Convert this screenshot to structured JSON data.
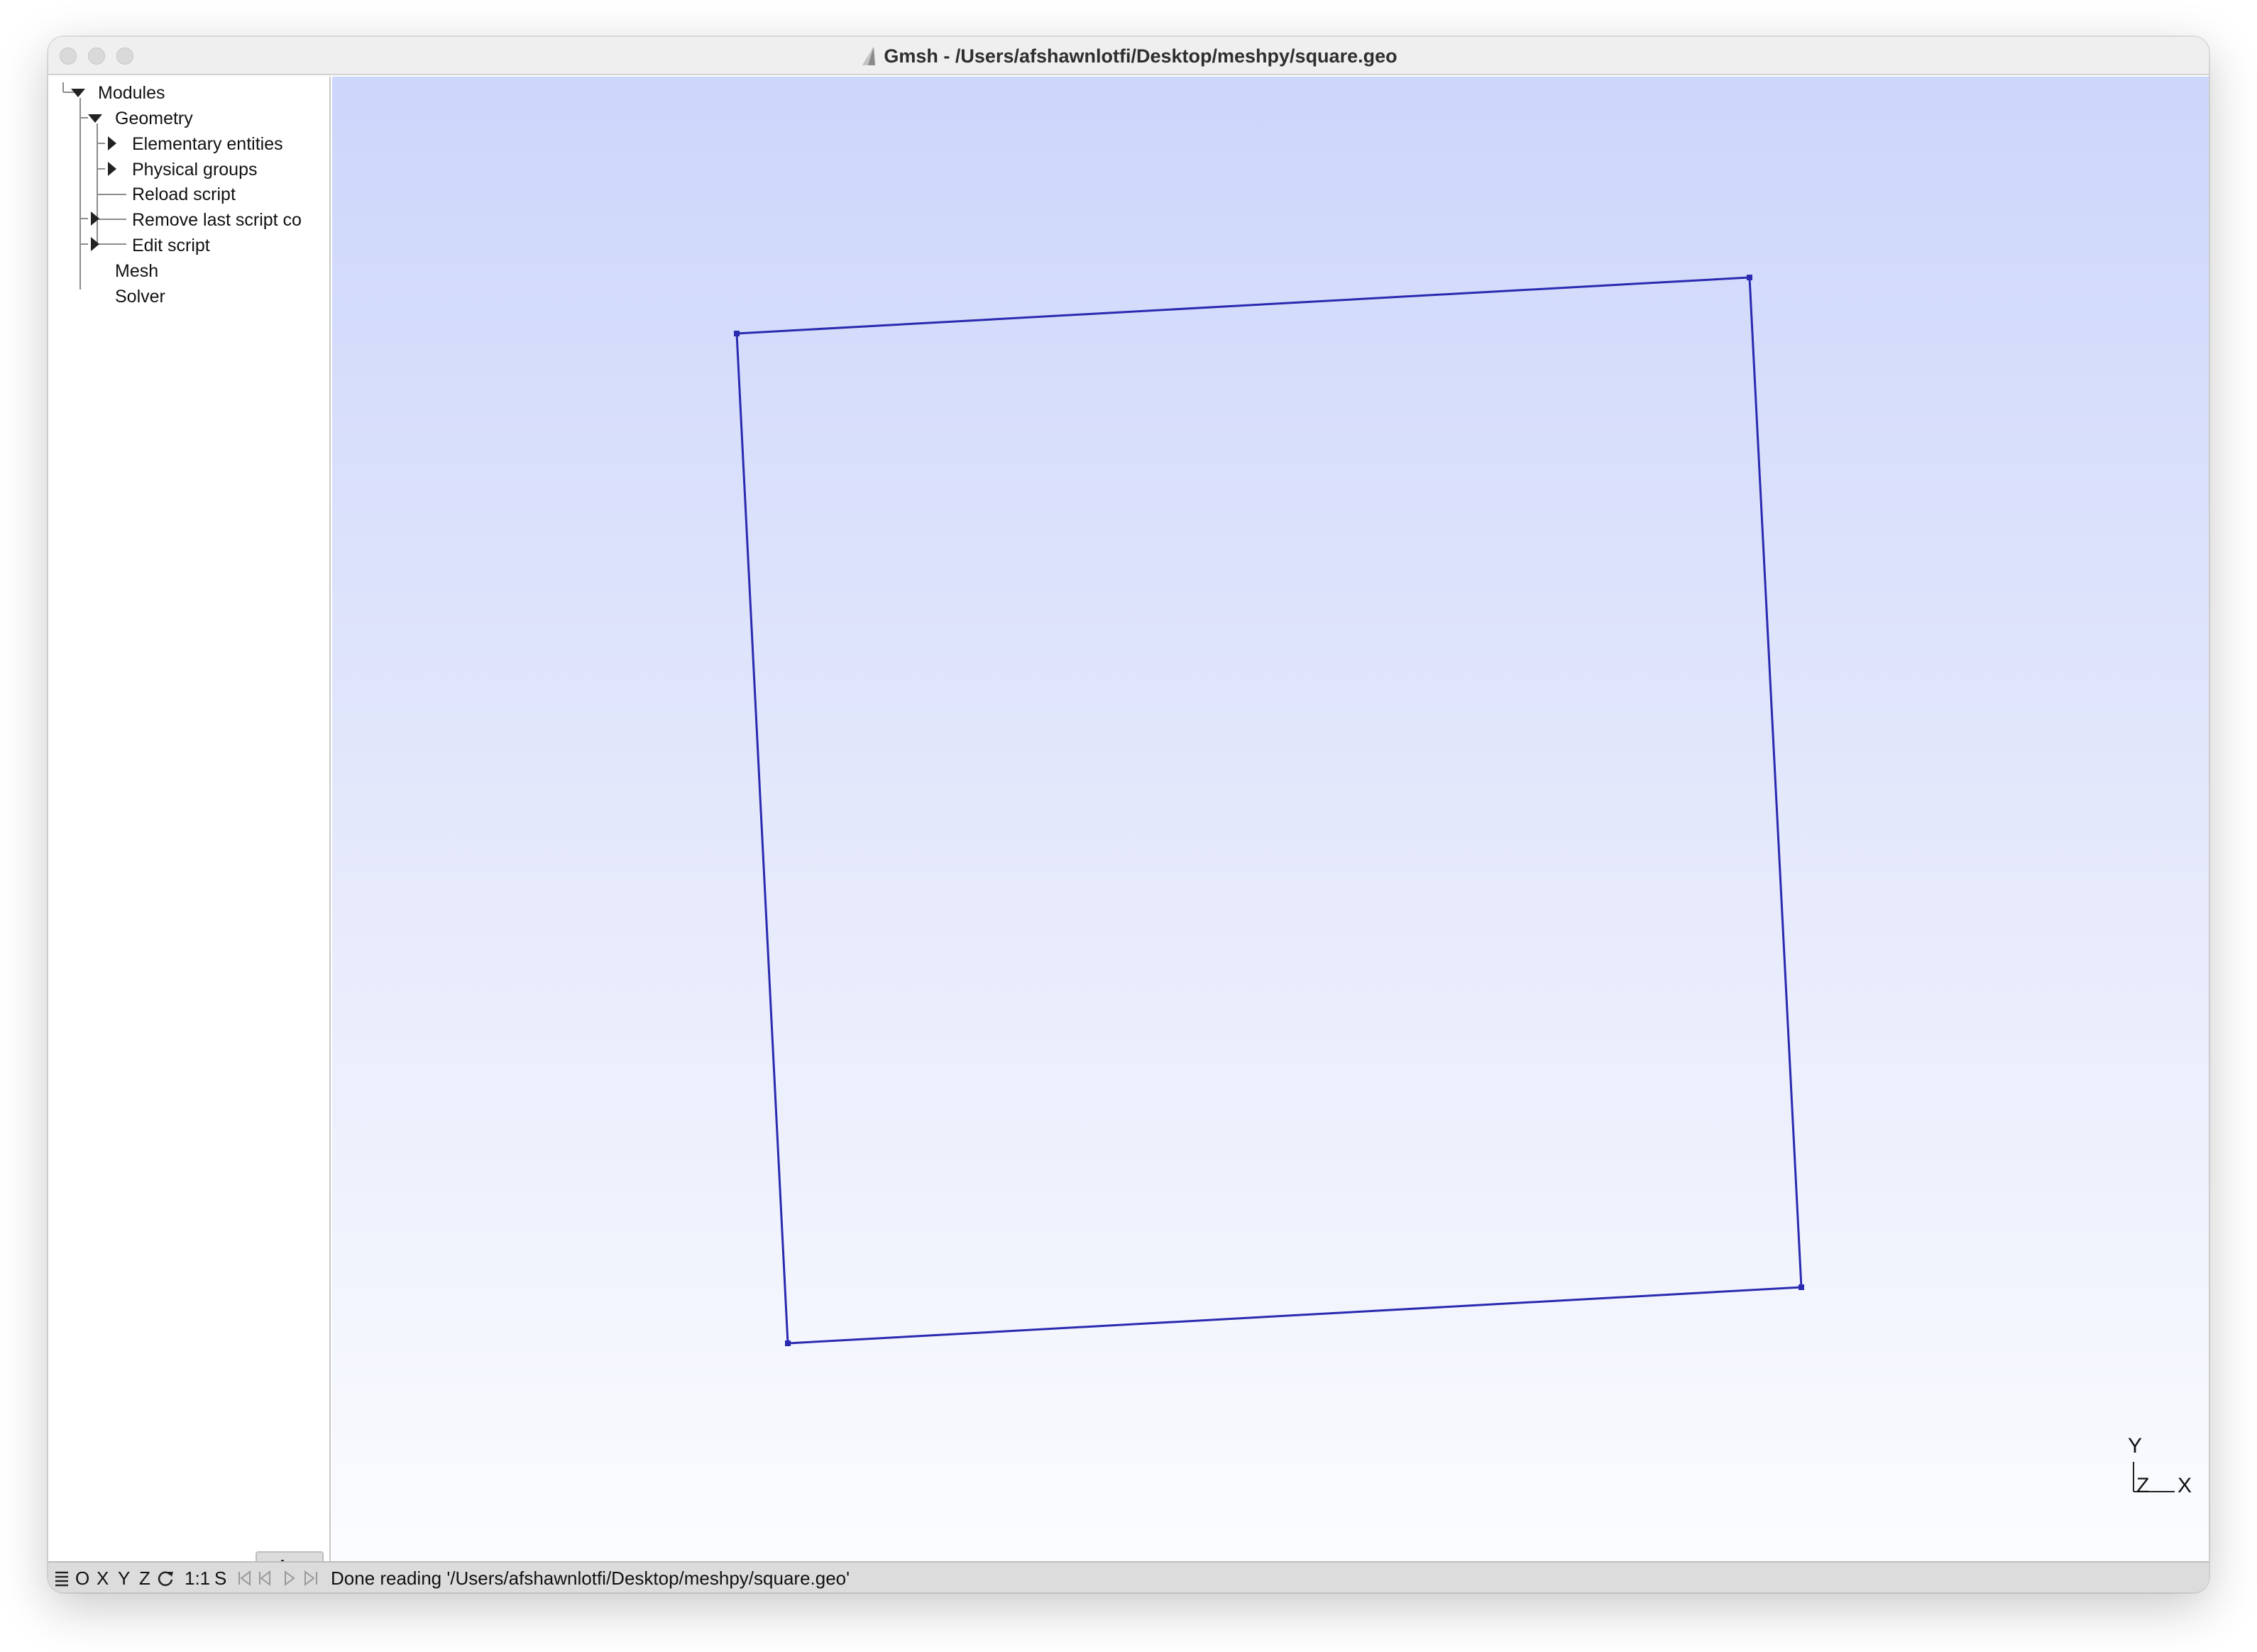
{
  "window": {
    "title": "Gmsh - /Users/afshawnlotfi/Desktop/meshpy/square.geo"
  },
  "tree": {
    "modules": "Modules",
    "geometry": "Geometry",
    "elementary": "Elementary entities",
    "physical": "Physical groups",
    "reload": "Reload script",
    "remove": "Remove last script co",
    "edit": "Edit script",
    "mesh": "Mesh",
    "solver": "Solver"
  },
  "statusbar": {
    "menu_icon": "hamburger-icon",
    "o": "O",
    "x": "X",
    "y": "Y",
    "z": "Z",
    "rotate_icon": "rotate-icon",
    "scale": "1:1",
    "s": "S",
    "message": "Done reading '/Users/afshawnlotfi/Desktop/meshpy/square.geo'"
  },
  "axes": {
    "y": "Y",
    "z": "Z",
    "x": "X"
  },
  "colors": {
    "geometry_line": "#2a2ab0",
    "viewport_top": "#cdd6fb",
    "viewport_bottom": "#fbfcff"
  }
}
